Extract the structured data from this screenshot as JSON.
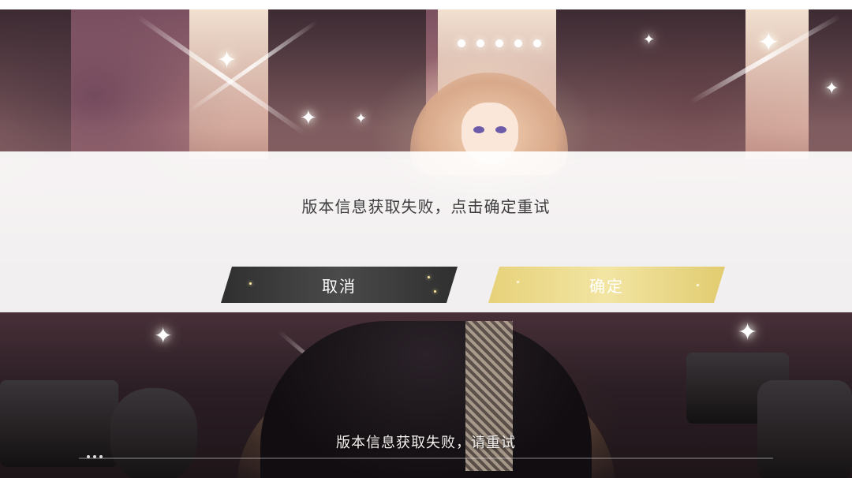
{
  "dialog": {
    "message": "版本信息获取失败，点击确定重试",
    "cancel_label": "取消",
    "confirm_label": "确定"
  },
  "status": {
    "message": "版本信息获取失败，请重试"
  },
  "colors": {
    "cancel_button": "#3a3a3a",
    "confirm_button": "#ecd987",
    "dialog_band": "#ffffff"
  },
  "icons": [
    "sparkle-icon",
    "loading-dots-icon"
  ]
}
